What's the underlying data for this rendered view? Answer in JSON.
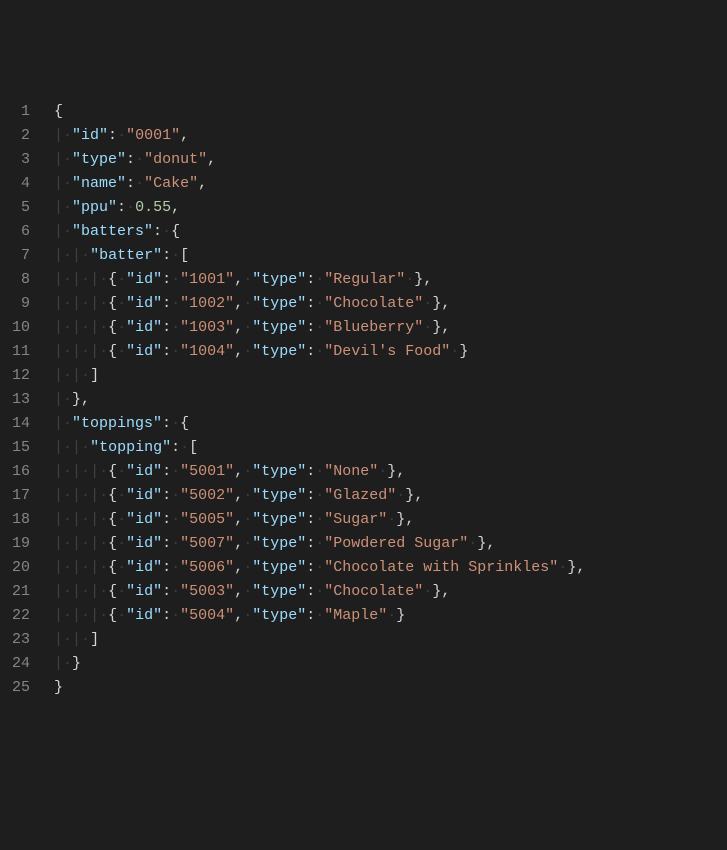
{
  "editor": {
    "lineStart": 1,
    "lineCount": 25,
    "indentDots": "·",
    "indentGuide": "|",
    "json": {
      "id": "0001",
      "type": "donut",
      "name": "Cake",
      "ppu": 0.55,
      "batters": {
        "batter": [
          {
            "id": "1001",
            "type": "Regular"
          },
          {
            "id": "1002",
            "type": "Chocolate"
          },
          {
            "id": "1003",
            "type": "Blueberry"
          },
          {
            "id": "1004",
            "type": "Devil's Food"
          }
        ]
      },
      "toppings": {
        "topping": [
          {
            "id": "5001",
            "type": "None"
          },
          {
            "id": "5002",
            "type": "Glazed"
          },
          {
            "id": "5005",
            "type": "Sugar"
          },
          {
            "id": "5007",
            "type": "Powdered Sugar"
          },
          {
            "id": "5006",
            "type": "Chocolate with Sprinkles"
          },
          {
            "id": "5003",
            "type": "Chocolate"
          },
          {
            "id": "5004",
            "type": "Maple"
          }
        ]
      }
    }
  }
}
